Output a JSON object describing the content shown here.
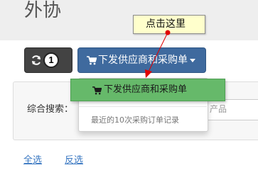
{
  "page": {
    "title": "外协"
  },
  "toolbar": {
    "refresh_badge": "1",
    "main_button_label": "下发供应商和采购单"
  },
  "dropdown": {
    "primary_item_label": "下发供应商和采购单",
    "recent_item_label": "最近的10次采购订单记录"
  },
  "search": {
    "label": "综合搜索：",
    "placeholder_fragment": "产品"
  },
  "callout": {
    "text": "点击这里"
  },
  "footer_links": {
    "select_all": "全选",
    "invert": "反选"
  },
  "colors": {
    "primary_button": "#3f6a9e",
    "highlight_item": "#66b96a",
    "callout_bg": "#ffffcc",
    "arrow": "#e00000",
    "link": "#3a78c2"
  },
  "icons": [
    "refresh-icon",
    "cart-icon",
    "caret-down-icon"
  ]
}
